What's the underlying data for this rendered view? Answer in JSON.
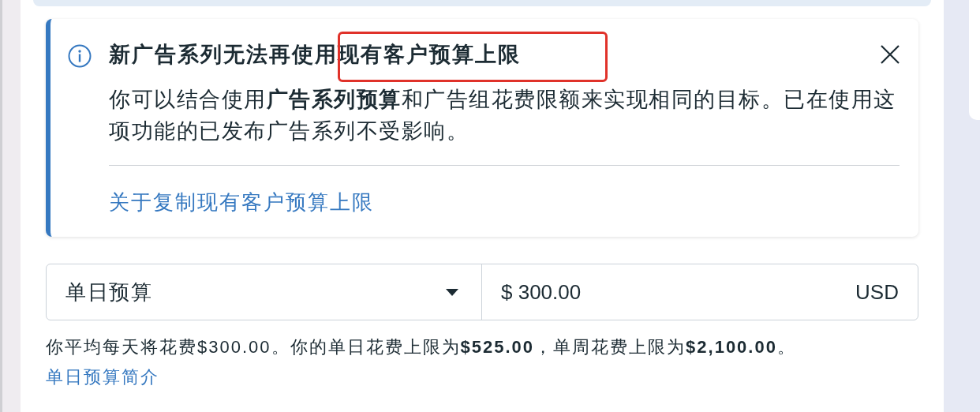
{
  "notice": {
    "title": "新广告系列无法再使用现有客户预算上限",
    "body": "你可以结合使用**广告系列预算**和广告组花费限额来实现相同的目标。已在使用这项功能的已发布广告系列不受影响。",
    "link": "关于复制现有客户预算上限"
  },
  "budget": {
    "type": "单日预算",
    "amount": "$ 300.00",
    "currency": "USD"
  },
  "summary": "你平均每天将花费$300.00。你的单日花费上限为**$525.00**，单周花费上限为**$2,100.00**。",
  "help_link": "单日预算简介"
}
